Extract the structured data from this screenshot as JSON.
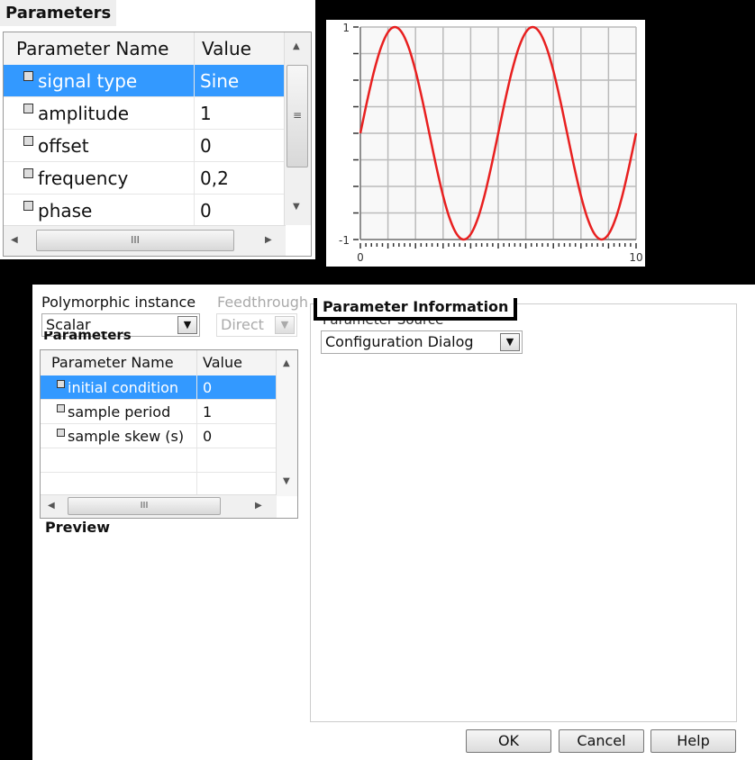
{
  "top_panel": {
    "title": "Parameters",
    "columns": [
      "Parameter Name",
      "Value"
    ],
    "rows": [
      {
        "name": "signal type",
        "value": "Sine",
        "selected": true
      },
      {
        "name": "amplitude",
        "value": "1"
      },
      {
        "name": "offset",
        "value": "0"
      },
      {
        "name": "frequency",
        "value": "0,2"
      },
      {
        "name": "phase",
        "value": "0"
      }
    ]
  },
  "chart_data": {
    "type": "line",
    "title": "",
    "xlabel": "",
    "ylabel": "",
    "xlim": [
      0,
      10
    ],
    "ylim": [
      -1,
      1
    ],
    "grid": true,
    "line_color": "#e82020",
    "x_tick_labels": [
      "0",
      "10"
    ],
    "y_tick_labels": [
      "1",
      "-1"
    ],
    "series": [
      {
        "x_start": 0,
        "x_step": 0.25,
        "values": [
          0,
          0.309,
          0.588,
          0.809,
          0.951,
          1,
          0.951,
          0.809,
          0.588,
          0.309,
          0,
          -0.309,
          -0.588,
          -0.809,
          -0.951,
          -1,
          -0.951,
          -0.809,
          -0.588,
          -0.309,
          0,
          0.309,
          0.588,
          0.809,
          0.951,
          1,
          0.951,
          0.809,
          0.588,
          0.309,
          0,
          -0.309,
          -0.588,
          -0.809,
          -0.951,
          -1,
          -0.951,
          -0.809,
          -0.588,
          -0.309,
          0
        ]
      }
    ]
  },
  "dialog": {
    "poly_label": "Polymorphic instance",
    "poly_value": "Scalar",
    "feed_label": "Feedthrough",
    "feed_value": "Direct",
    "params_title": "Parameters",
    "columns": [
      "Parameter Name",
      "Value"
    ],
    "rows": [
      {
        "name": "initial condition",
        "value": "0",
        "selected": true
      },
      {
        "name": "sample period",
        "value": "1"
      },
      {
        "name": "sample skew (s)",
        "value": "0"
      }
    ],
    "preview_title": "Preview",
    "info_title": "Parameter Information",
    "source_label": "Parameter Source",
    "source_value": "Configuration Dialog",
    "ok": "OK",
    "cancel": "Cancel",
    "help": "Help"
  }
}
